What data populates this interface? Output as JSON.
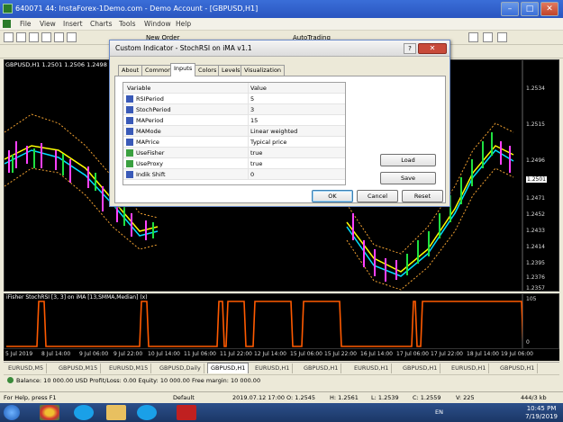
{
  "window": {
    "title": "640071 44: InstaForex-1Demo.com - Demo Account - [GBPUSD,H1]"
  },
  "menu": [
    "File",
    "View",
    "Insert",
    "Charts",
    "Tools",
    "Window",
    "Help"
  ],
  "toolbar": {
    "new_order": "New Order",
    "autotrading": "AutoTrading"
  },
  "chart": {
    "header": "GBPUSD,H1  1.2501 1.2506 1.2498 1.25...",
    "price_labels": [
      "1.2534",
      "1.2515",
      "1.2496",
      "1.2501",
      "1.2471",
      "1.2452",
      "1.2433",
      "1.2414",
      "1.2395",
      "1.2376",
      "1.2357"
    ],
    "price_marker": "1.2501"
  },
  "indicator": {
    "header": "iFisher StochRSI [3, 3] on iMA [13,SMMA,Median] (x)",
    "scale": [
      "105",
      "0",
      "-5"
    ]
  },
  "time_axis": [
    "5 Jul 2019",
    "8 Jul 14:00",
    "9 Jul 06:00",
    "9 Jul 22:00",
    "10 Jul 14:00",
    "11 Jul 06:00",
    "11 Jul 22:00",
    "12 Jul 14:00",
    "15 Jul 06:00",
    "15 Jul 22:00",
    "16 Jul 14:00",
    "17 Jul 06:00",
    "17 Jul 22:00",
    "18 Jul 14:00",
    "19 Jul 06:00"
  ],
  "chart_tabs": [
    "EURUSD,M5",
    "GBPUSD,M15",
    "EURUSD,M15",
    "GBPUSD,Daily",
    "GBPUSD,H1",
    "EURUSD,H1",
    "GBPUSD,H1",
    "EURUSD,H1",
    "GBPUSD,H1",
    "EURUSD,H1",
    "GBPUSD,H1",
    "EURUSD,H1"
  ],
  "active_tab_index": 4,
  "balance": "Balance: 10 000.00 USD  Profit/Loss: 0.00  Equity: 10 000.00  Free margin: 10 000.00",
  "status": {
    "help": "For Help, press F1",
    "profile": "Default",
    "datetime": "2019.07.12 17:00",
    "open": "O: 1.2545",
    "high": "H: 1.2561",
    "low": "L: 1.2539",
    "close": "C: 1.2559",
    "volume": "V: 225",
    "traffic": "444/3 kb"
  },
  "taskbar": {
    "lang": "EN",
    "time": "10:45 PM",
    "date": "7/19/2019"
  },
  "dialog": {
    "title": "Custom Indicator - StochRSI on iMA v1.1",
    "help": "?",
    "close": "✕",
    "tabs": [
      "About",
      "Common",
      "Inputs",
      "Colors",
      "Levels",
      "Visualization"
    ],
    "active_tab": 2,
    "columns": [
      "Variable",
      "Value"
    ],
    "params": [
      {
        "name": "RSIPeriod",
        "value": "5",
        "icon": "int"
      },
      {
        "name": "StochPeriod",
        "value": "3",
        "icon": "int"
      },
      {
        "name": "MAPeriod",
        "value": "15",
        "icon": "int"
      },
      {
        "name": "MAMode",
        "value": "Linear weighted",
        "icon": "int"
      },
      {
        "name": "MAPrice",
        "value": "Typical price",
        "icon": "int"
      },
      {
        "name": "UseFisher",
        "value": "true",
        "icon": "bool"
      },
      {
        "name": "UseProxy",
        "value": "true",
        "icon": "bool"
      },
      {
        "name": "Indik Shift",
        "value": "0",
        "icon": "int"
      }
    ],
    "load": "Load",
    "save": "Save",
    "ok": "OK",
    "cancel": "Cancel",
    "reset": "Reset"
  }
}
